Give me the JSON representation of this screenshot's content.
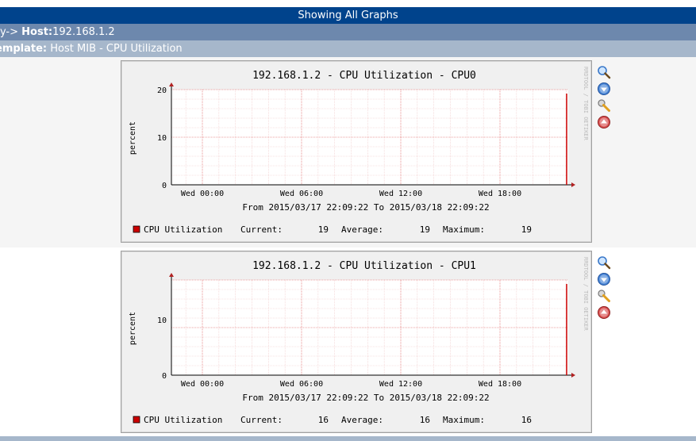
{
  "header": {
    "title": "Showing All Graphs"
  },
  "host_bar": {
    "prefix": "oy->",
    "host_label": "Host:",
    "host_value": "192.168.1.2"
  },
  "template_bar": {
    "label": "emplate:",
    "value": "Host MIB - CPU Utilization"
  },
  "graphs": [
    {
      "title": "192.168.1.2 - CPU Utilization - CPU0",
      "ylabel": "percent",
      "yticks": [
        "20",
        "10",
        "0"
      ],
      "xticks": [
        "Wed 00:00",
        "Wed 06:00",
        "Wed 12:00",
        "Wed 18:00"
      ],
      "watermark": "RRDTOOL / TOBI OETIKER",
      "time_range": "From 2015/03/17 22:09:22 To 2015/03/18 22:09:22",
      "legend": {
        "name": "CPU Utilization",
        "current_label": "Current:",
        "current": "19",
        "average_label": "Average:",
        "average": "19",
        "maximum_label": "Maximum:",
        "maximum": "19"
      }
    },
    {
      "title": "192.168.1.2 - CPU Utilization - CPU1",
      "ylabel": "percent",
      "yticks": [
        "10",
        "0"
      ],
      "xticks": [
        "Wed 00:00",
        "Wed 06:00",
        "Wed 12:00",
        "Wed 18:00"
      ],
      "watermark": "RRDTOOL / TOBI OETIKER",
      "time_range": "From 2015/03/17 22:09:22 To 2015/03/18 22:09:22",
      "legend": {
        "name": "CPU Utilization",
        "current_label": "Current:",
        "current": "16",
        "average_label": "Average:",
        "average": "16",
        "maximum_label": "Maximum:",
        "maximum": "16"
      }
    }
  ],
  "icons": [
    "zoom-icon",
    "download-icon",
    "properties-icon",
    "move-up-icon"
  ],
  "colors": {
    "header": "#00438c",
    "host_bar": "#6d88ad",
    "template_bar": "#a6b7cb",
    "line": "#cc0000"
  }
}
